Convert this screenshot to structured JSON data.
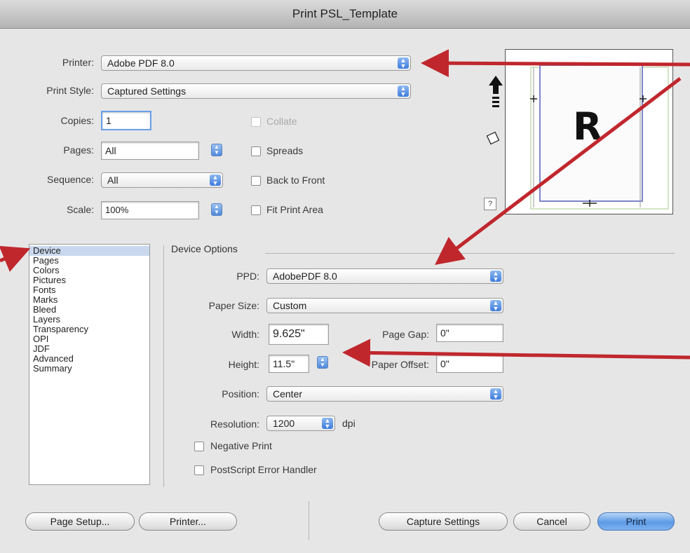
{
  "window": {
    "title": "Print PSL_Template"
  },
  "top": {
    "printer_label": "Printer:",
    "printer_value": "Adobe PDF 8.0",
    "print_style_label": "Print Style:",
    "print_style_value": "Captured Settings",
    "copies_label": "Copies:",
    "copies_value": "1",
    "pages_label": "Pages:",
    "pages_value": "All",
    "sequence_label": "Sequence:",
    "sequence_value": "All",
    "scale_label": "Scale:",
    "scale_value": "100%",
    "collate_label": "Collate",
    "spreads_label": "Spreads",
    "back_to_front_label": "Back to Front",
    "fit_print_area_label": "Fit Print Area"
  },
  "preview": {
    "letter": "R",
    "help": "?"
  },
  "sidebar": {
    "items": [
      "Device",
      "Pages",
      "Colors",
      "Pictures",
      "Fonts",
      "Marks",
      "Bleed",
      "Layers",
      "Transparency",
      "OPI",
      "JDF",
      "Advanced",
      "Summary"
    ],
    "selected": "Device"
  },
  "device": {
    "section_title": "Device Options",
    "ppd_label": "PPD:",
    "ppd_value": "AdobePDF 8.0",
    "paper_size_label": "Paper Size:",
    "paper_size_value": "Custom",
    "width_label": "Width:",
    "width_value": "9.625\"",
    "height_label": "Height:",
    "height_value": "11.5\"",
    "page_gap_label": "Page Gap:",
    "page_gap_value": "0\"",
    "paper_offset_label": "Paper Offset:",
    "paper_offset_value": "0\"",
    "position_label": "Position:",
    "position_value": "Center",
    "resolution_label": "Resolution:",
    "resolution_value": "1200",
    "resolution_unit": "dpi",
    "negative_print_label": "Negative Print",
    "ps_error_label": "PostScript Error Handler"
  },
  "buttons": {
    "page_setup": "Page Setup...",
    "printer": "Printer...",
    "capture_settings": "Capture Settings",
    "cancel": "Cancel",
    "print": "Print"
  },
  "colors": {
    "arrow": "#c0272d",
    "selection": "#c9d8ee",
    "accent": "#3d7cde"
  }
}
